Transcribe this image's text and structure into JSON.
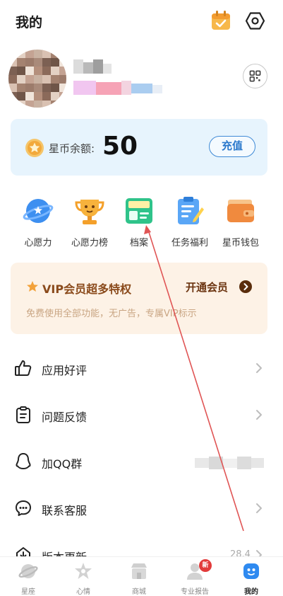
{
  "header": {
    "title": "我的",
    "calendar_icon": "calendar-check-icon",
    "settings_icon": "hexagon-gear-icon"
  },
  "profile": {
    "avatar_icon": "pixelated-avatar",
    "qr_icon": "qr-code-icon"
  },
  "coins": {
    "label": "星币余额:",
    "amount": "50",
    "recharge_label": "充值",
    "coin_icon": "star-coin-icon"
  },
  "quick_actions": [
    {
      "label": "心愿力",
      "icon": "planet-icon"
    },
    {
      "label": "心愿力榜",
      "icon": "trophy-icon"
    },
    {
      "label": "档案",
      "icon": "id-card-icon"
    },
    {
      "label": "任务福利",
      "icon": "clipboard-pen-icon"
    },
    {
      "label": "星币钱包",
      "icon": "wallet-icon"
    }
  ],
  "vip": {
    "title": "VIP会员超多特权",
    "open_label": "开通会员",
    "subtitle": "免费使用全部功能，无广告，专属VIP标示"
  },
  "menu": [
    {
      "label": "应用好评",
      "icon": "thumbs-up-icon"
    },
    {
      "label": "问题反馈",
      "icon": "clipboard-icon"
    },
    {
      "label": "加QQ群",
      "icon": "qq-penguin-icon"
    },
    {
      "label": "联系客服",
      "icon": "chat-bubble-icon"
    },
    {
      "label": "版本更新",
      "icon": "update-icon",
      "value": "28.4"
    }
  ],
  "tabs": [
    {
      "label": "星座",
      "icon": "planet-tab-icon"
    },
    {
      "label": "心情",
      "icon": "mood-tab-icon"
    },
    {
      "label": "商城",
      "icon": "store-tab-icon"
    },
    {
      "label": "专业报告",
      "icon": "report-tab-icon",
      "badge": "新"
    },
    {
      "label": "我的",
      "icon": "me-tab-icon",
      "active": true
    }
  ],
  "colors": {
    "accent_blue": "#3f8ad6",
    "coin_bg": "#e7f4fd",
    "vip_bg": "#fdf2e6",
    "badge_red": "#e23b3b",
    "annotation_red": "#e05555"
  }
}
